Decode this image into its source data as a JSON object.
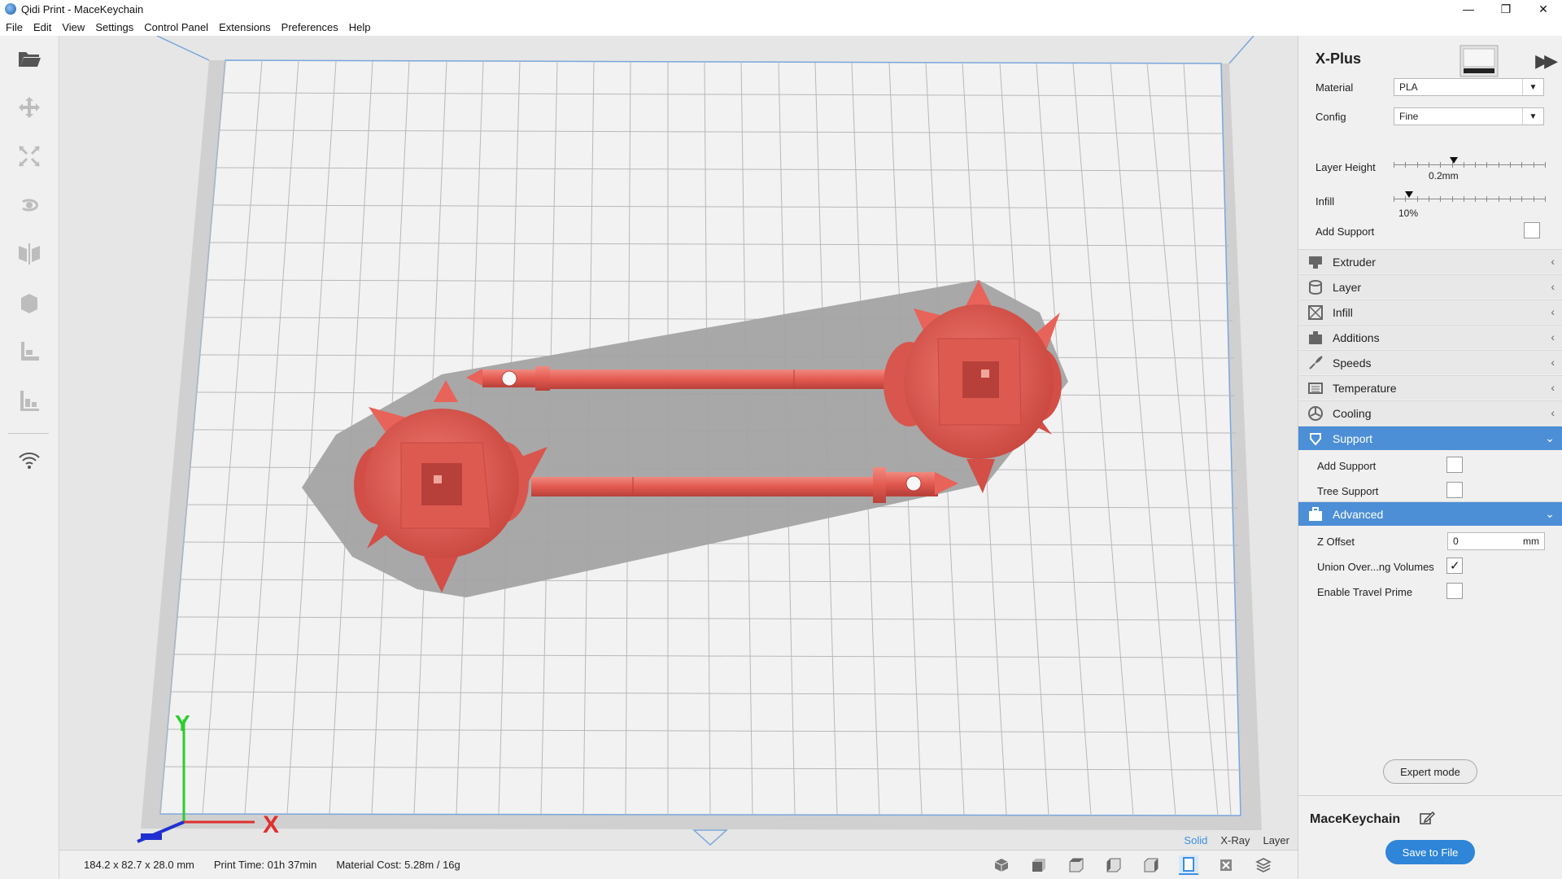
{
  "window": {
    "title": "Qidi Print - MaceKeychain",
    "controls": {
      "minimize": "—",
      "restore": "❐",
      "close": "✕"
    }
  },
  "menu": [
    "File",
    "Edit",
    "View",
    "Settings",
    "Control Panel",
    "Extensions",
    "Preferences",
    "Help"
  ],
  "left_toolbar": {
    "tools": [
      "open-folder-icon",
      "move-icon",
      "scale-icon",
      "rotate-icon",
      "mirror-icon",
      "per-model-settings-icon",
      "support-blocker-icon",
      "layer-view-icon",
      "wifi-icon"
    ]
  },
  "viewport": {
    "axis_labels": {
      "y": "Y",
      "x": "X"
    },
    "view_modes": [
      "Solid",
      "X-Ray",
      "Layer"
    ],
    "active_view_mode": "Solid"
  },
  "status": {
    "dimensions": "184.2 x 82.7 x 28.0 mm",
    "print_time": "Print Time: 01h 37min",
    "material_cost": "Material Cost: 5.28m / 16g"
  },
  "camera_views": [
    "3d-view-icon",
    "front-view-icon",
    "top-view-icon",
    "left-view-icon",
    "right-view-icon",
    "print-area-icon",
    "xray-icon",
    "layers-icon"
  ],
  "panel": {
    "printer": "X-Plus",
    "material_label": "Material",
    "material_value": "PLA",
    "config_label": "Config",
    "config_value": "Fine",
    "layer_height_label": "Layer Height",
    "layer_height_value": "0.2mm",
    "layer_height_fraction": 0.4,
    "infill_label": "Infill",
    "infill_value": "10%",
    "infill_fraction": 0.1,
    "add_support_label": "Add Support",
    "add_support_checked": false,
    "sections": [
      {
        "label": "Extruder",
        "icon": "extruder-icon",
        "open": false
      },
      {
        "label": "Layer",
        "icon": "layer-icon",
        "open": false
      },
      {
        "label": "Infill",
        "icon": "infill-icon",
        "open": false
      },
      {
        "label": "Additions",
        "icon": "additions-icon",
        "open": false
      },
      {
        "label": "Speeds",
        "icon": "speeds-icon",
        "open": false
      },
      {
        "label": "Temperature",
        "icon": "temperature-icon",
        "open": false
      },
      {
        "label": "Cooling",
        "icon": "cooling-icon",
        "open": false
      },
      {
        "label": "Support",
        "icon": "support-icon",
        "open": true
      },
      {
        "label": "Advanced",
        "icon": "advanced-icon",
        "open": true
      }
    ],
    "support": {
      "add_support_label": "Add Support",
      "add_support_checked": false,
      "tree_support_label": "Tree Support",
      "tree_support_checked": false
    },
    "advanced": {
      "z_offset_label": "Z Offset",
      "z_offset_value": "0",
      "z_offset_unit": "mm",
      "union_label": "Union Over...ng Volumes",
      "union_checked": true,
      "travel_prime_label": "Enable Travel Prime",
      "travel_prime_checked": false
    },
    "expert_mode_label": "Expert mode",
    "job_name": "MaceKeychain",
    "save_label": "Save to File"
  },
  "colors": {
    "accent": "#3b8fe3",
    "model": "#e8635a",
    "section_open": "#4c8fd6",
    "save_button": "#2f85d8"
  }
}
